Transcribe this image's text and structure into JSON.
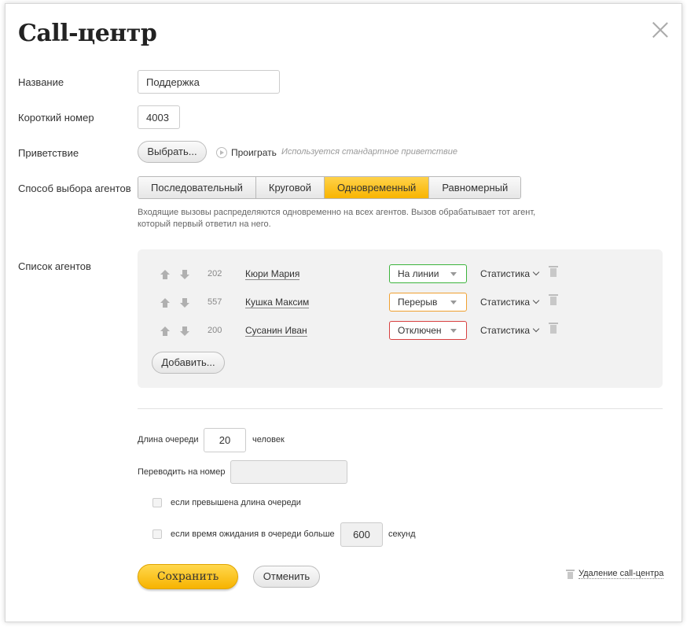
{
  "dialog": {
    "title": "Call-центр"
  },
  "form": {
    "name_label": "Название",
    "name_value": "Поддержка",
    "short_label": "Короткий номер",
    "short_value": "4003",
    "greeting_label": "Приветствие",
    "choose_btn": "Выбрать...",
    "play_label": "Проиграть",
    "greeting_hint": "Используется стандартное приветствие",
    "method_label": "Способ выбора агентов",
    "methods": [
      "Последовательный",
      "Круговой",
      "Одновременный",
      "Равномерный"
    ],
    "active_method": "Одновременный",
    "method_desc": "Входящие вызовы распределяются одновременно на всех агентов. Вызов обрабатывает тот агент, который первый ответил на него.",
    "agents_label": "Список агентов"
  },
  "agents": [
    {
      "num": "202",
      "name": "Кюри Мария",
      "status": "На линии",
      "status_color": "#3cb43c",
      "stats": "Статистика"
    },
    {
      "num": "557",
      "name": "Кушка Максим",
      "status": "Перерыв",
      "status_color": "#f0a030",
      "stats": "Статистика"
    },
    {
      "num": "200",
      "name": "Сусанин Иван",
      "status": "Отключен",
      "status_color": "#d84040",
      "stats": "Статистика"
    }
  ],
  "add_btn": "Добавить...",
  "queue": {
    "length_label": "Длина очереди",
    "length_value": "20",
    "length_unit": "человек",
    "forward_label": "Переводить на номер",
    "forward_value": "",
    "cond1": "если превышена длина очереди",
    "cond2": "если время ожидания в очереди больше",
    "wait_value": "600",
    "wait_unit": "секунд"
  },
  "actions": {
    "save": "Сохранить",
    "cancel": "Отменить",
    "delete": "Удаление call-центра"
  }
}
